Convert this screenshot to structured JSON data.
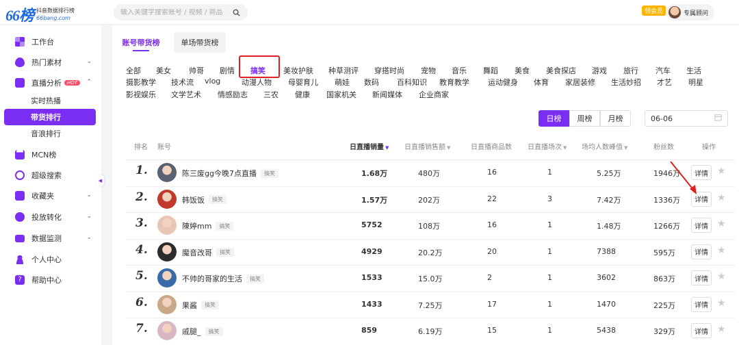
{
  "brand": {
    "logo": "66榜",
    "line1": "抖音数据排行榜",
    "line2": "66bang.com"
  },
  "search": {
    "placeholder": "输入关键字搜索账号 / 视频 / 商品"
  },
  "header": {
    "vip": "领会员",
    "user": "专属顾问"
  },
  "sidebar": {
    "items": [
      {
        "label": "工作台",
        "icon": "grid-icon"
      },
      {
        "label": "热门素材",
        "icon": "flame-icon"
      },
      {
        "label": "直播分析",
        "icon": "live-icon",
        "badge": "HOT"
      },
      {
        "label": "MCN榜",
        "icon": "building-icon"
      },
      {
        "label": "超级搜索",
        "icon": "search-icon"
      },
      {
        "label": "收藏夹",
        "icon": "star-icon"
      },
      {
        "label": "投放转化",
        "icon": "send-icon"
      },
      {
        "label": "数据监测",
        "icon": "monitor-icon"
      },
      {
        "label": "个人中心",
        "icon": "user-icon"
      },
      {
        "label": "帮助中心",
        "icon": "help-icon"
      }
    ],
    "sub": [
      "实时热播",
      "带货排行",
      "音浪排行"
    ],
    "accent": "#7a2ef2"
  },
  "tabs": [
    "账号带货榜",
    "单场带货榜"
  ],
  "categories": [
    [
      "全部",
      "美女",
      "帅哥",
      "剧情",
      "搞笑",
      "美妆护肤",
      "种草测评",
      "穿搭时尚",
      "宠物",
      "音乐",
      "舞蹈",
      "美食",
      "美食探店",
      "游戏",
      "旅行",
      "汽车",
      "生活"
    ],
    [
      "摄影教学",
      "技术流",
      "vlog",
      "动漫人物",
      "母婴育儿",
      "萌娃",
      "数码",
      "百科知识",
      "教育教学",
      "运动健身",
      "体育",
      "家居装修",
      "生活妙招",
      "才艺",
      "明星"
    ],
    [
      "影视娱乐",
      "文学艺术",
      "情感励志",
      "三农",
      "健康",
      "国家机关",
      "新闻媒体",
      "企业商家"
    ]
  ],
  "period": {
    "day": "日榜",
    "week": "周榜",
    "month": "月榜",
    "date": "06-06"
  },
  "table": {
    "headers": [
      "排名",
      "账号",
      "日直播销量",
      "日直播销售额",
      "日直播商品数",
      "日直播场次",
      "场均人数峰值",
      "粉丝数",
      "操作"
    ],
    "detail_label": "详情",
    "rows": [
      {
        "rank": "1.",
        "name": "陈三废gg今晚7点直播",
        "tag": "搞笑",
        "sales": "1.68万",
        "revenue": "480万",
        "products": "16",
        "sessions": "1",
        "peak": "5.25万",
        "fans": "1946万"
      },
      {
        "rank": "2.",
        "name": "韩饭饭",
        "tag": "搞笑",
        "sales": "1.57万",
        "revenue": "202万",
        "products": "22",
        "sessions": "3",
        "peak": "7.42万",
        "fans": "1336万"
      },
      {
        "rank": "3.",
        "name": "陳婷mm",
        "tag": "搞笑",
        "sales": "5752",
        "revenue": "108万",
        "products": "16",
        "sessions": "1",
        "peak": "1.48万",
        "fans": "1266万"
      },
      {
        "rank": "4.",
        "name": "魔音改哥",
        "tag": "搞笑",
        "sales": "4929",
        "revenue": "20.2万",
        "products": "20",
        "sessions": "1",
        "peak": "7388",
        "fans": "595万"
      },
      {
        "rank": "5.",
        "name": "不帅的哥家的生活",
        "tag": "搞笑",
        "sales": "1533",
        "revenue": "15.0万",
        "products": "2",
        "sessions": "1",
        "peak": "3602",
        "fans": "863万"
      },
      {
        "rank": "6.",
        "name": "果酱",
        "tag": "搞笑",
        "sales": "1433",
        "revenue": "7.25万",
        "products": "17",
        "sessions": "1",
        "peak": "1470",
        "fans": "225万"
      },
      {
        "rank": "7.",
        "name": "戚腿_",
        "tag": "搞笑",
        "sales": "859",
        "revenue": "6.19万",
        "products": "15",
        "sessions": "1",
        "peak": "5438",
        "fans": "329万"
      }
    ]
  }
}
